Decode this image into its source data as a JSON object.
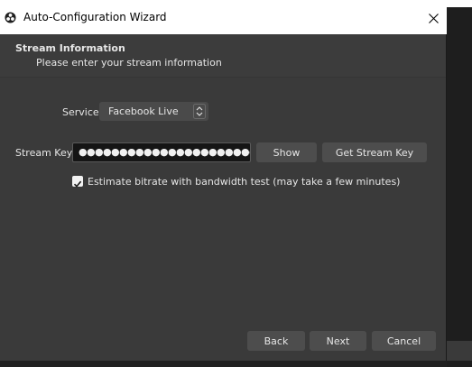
{
  "window": {
    "title": "Auto-Configuration Wizard",
    "app_icon": "obs-logo-icon",
    "close_icon": "close-icon"
  },
  "header": {
    "title": "Stream Information",
    "subtitle": "Please enter your stream information"
  },
  "service": {
    "label": "Service",
    "selected": "Facebook Live",
    "icon": "up-down-chevron-icon"
  },
  "stream_key": {
    "label": "Stream Key",
    "masked_value": "●●●●●●●●●●●●●●●●●●●●●●●●●●●●●",
    "show_label": "Show",
    "get_key_label": "Get Stream Key"
  },
  "bandwidth_test": {
    "label": "Estimate bitrate with bandwidth test (may take a few minutes)",
    "checked": true
  },
  "footer": {
    "back_label": "Back",
    "next_label": "Next",
    "cancel_label": "Cancel"
  },
  "colors": {
    "dialog_bg": "#3a3a3a",
    "button_bg": "#4d4d4d",
    "input_bg": "#151515",
    "text": "#e6e6e6"
  }
}
